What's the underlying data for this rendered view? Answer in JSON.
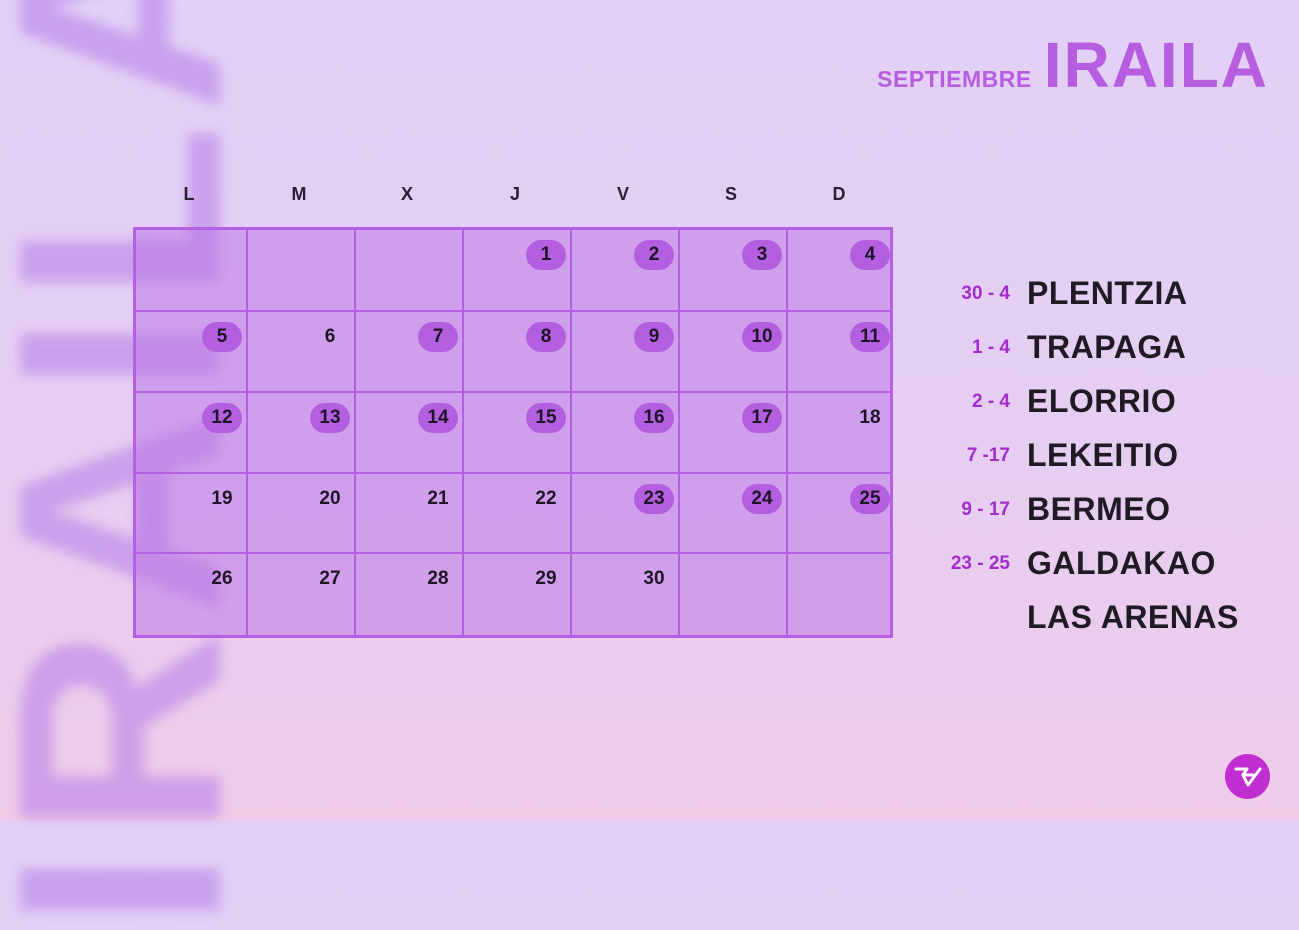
{
  "background_word": "IRAILA",
  "header": {
    "subtitle": "SEPTIEMBRE",
    "title": "IRAILA"
  },
  "weekdays": [
    "L",
    "M",
    "X",
    "J",
    "V",
    "S",
    "D"
  ],
  "calendar": {
    "first_weekday_index": 3,
    "days_in_month": 30,
    "highlighted_days": [
      1,
      2,
      3,
      4,
      5,
      7,
      8,
      9,
      10,
      11,
      12,
      13,
      14,
      15,
      16,
      17,
      23,
      24,
      25
    ]
  },
  "legend": [
    {
      "range": "30 - 4",
      "town": "PLENTZIA"
    },
    {
      "range": "1 - 4",
      "town": "TRAPAGA"
    },
    {
      "range": "2 - 4",
      "town": "ELORRIO"
    },
    {
      "range": "7 -17",
      "town": "LEKEITIO"
    },
    {
      "range": "9 - 17",
      "town": "BERMEO"
    },
    {
      "range": "23 - 25",
      "town": "GALDAKAO"
    },
    {
      "range": "",
      "town": "LAS ARENAS"
    }
  ],
  "colors": {
    "accent": "#b75ddf",
    "highlight": "#b45ee0",
    "range_text": "#a22ccc",
    "logo": "#c02ed2"
  },
  "logo": {
    "icon": "brand-logo-icon"
  }
}
